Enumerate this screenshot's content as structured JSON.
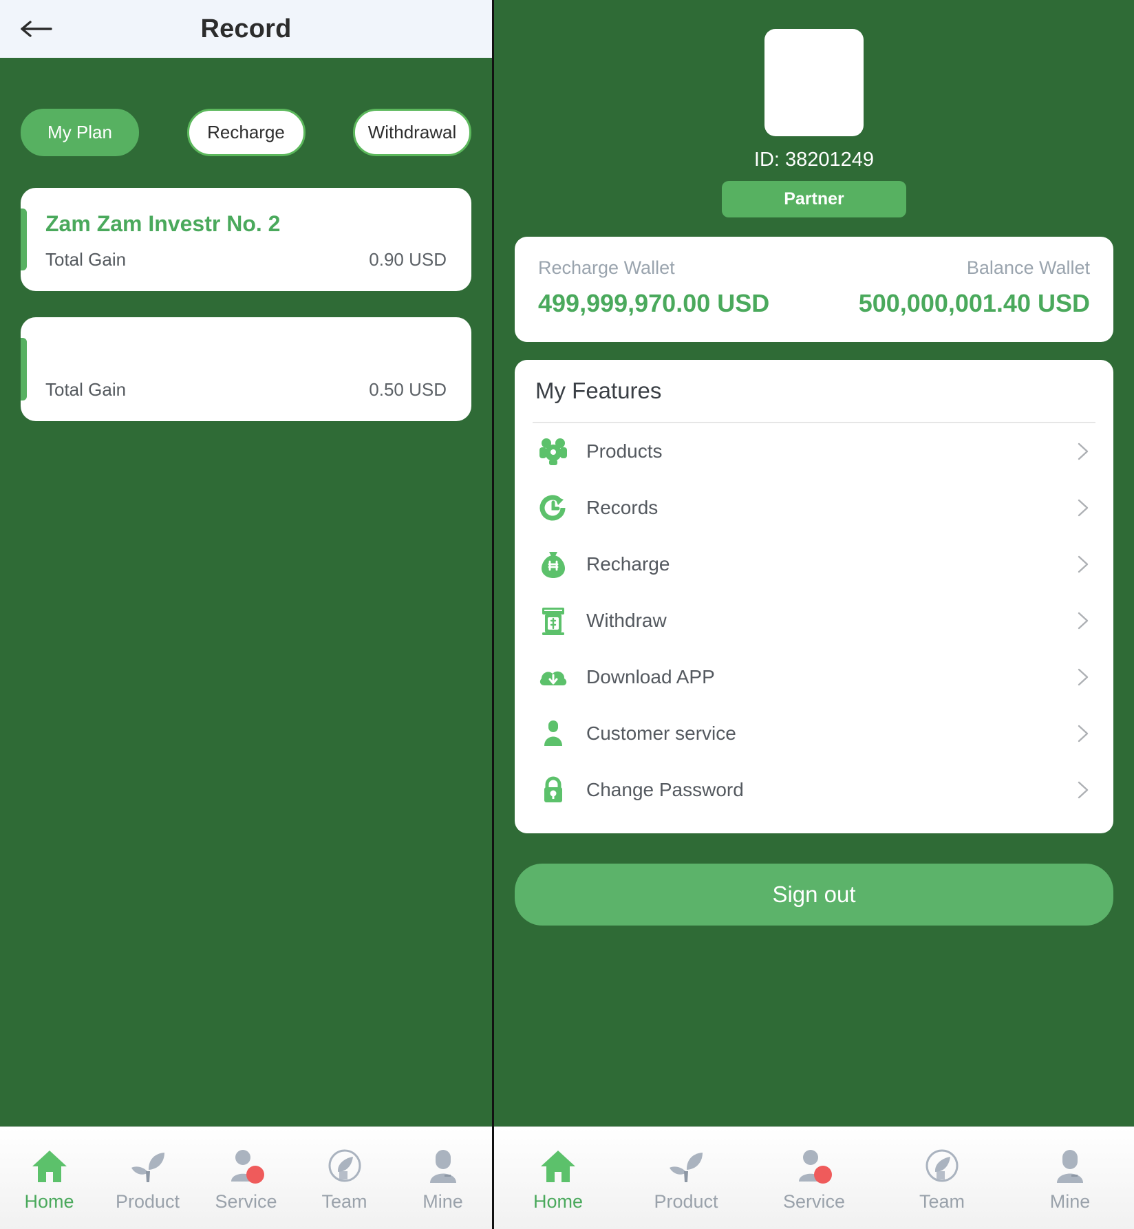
{
  "colors": {
    "background_green": "#2f6b36",
    "accent_green": "#57b161",
    "light_green": "#5cb36a",
    "text_green": "#4aa95c",
    "topbar_bg": "#f1f5fb",
    "badge_red": "#ef5b5b",
    "muted_gray": "#9aa2ab"
  },
  "left_screen": {
    "topbar": {
      "back_icon": "arrow-left-icon",
      "title": "Record"
    },
    "tabs": [
      {
        "label": "My Plan",
        "active": true
      },
      {
        "label": "Recharge",
        "active": false
      },
      {
        "label": "Withdrawal",
        "active": false
      }
    ],
    "plans": [
      {
        "title": "Zam Zam Investr No. 2",
        "gain_label": "Total Gain",
        "gain_value": "0.90 USD"
      },
      {
        "title": "",
        "gain_label": "Total Gain",
        "gain_value": "0.50 USD"
      }
    ]
  },
  "right_screen": {
    "profile": {
      "avatar": "avatar-placeholder",
      "user_id": "ID: 38201249",
      "rank_badge": "Partner"
    },
    "wallets": [
      {
        "label": "Recharge Wallet",
        "amount": "499,999,970.00 USD"
      },
      {
        "label": "Balance Wallet",
        "amount": "500,000,001.40 USD"
      }
    ],
    "features": {
      "title": "My Features",
      "items": [
        {
          "label": "Products",
          "icon": "products-icon"
        },
        {
          "label": "Records",
          "icon": "history-icon"
        },
        {
          "label": "Recharge",
          "icon": "money-bag-icon"
        },
        {
          "label": "Withdraw",
          "icon": "atm-icon"
        },
        {
          "label": "Download APP",
          "icon": "cloud-download-icon"
        },
        {
          "label": "Customer service",
          "icon": "person-icon"
        },
        {
          "label": "Change Password",
          "icon": "lock-icon"
        }
      ]
    },
    "signout_label": "Sign out"
  },
  "bottom_nav": {
    "items": [
      {
        "label": "Home",
        "icon": "home-icon",
        "active": true,
        "badge": false
      },
      {
        "label": "Product",
        "icon": "sprout-icon",
        "active": false,
        "badge": false
      },
      {
        "label": "Service",
        "icon": "service-person-icon",
        "active": false,
        "badge": true
      },
      {
        "label": "Team",
        "icon": "team-circle-icon",
        "active": false,
        "badge": false
      },
      {
        "label": "Mine",
        "icon": "user-bust-icon",
        "active": false,
        "badge": false
      }
    ]
  }
}
